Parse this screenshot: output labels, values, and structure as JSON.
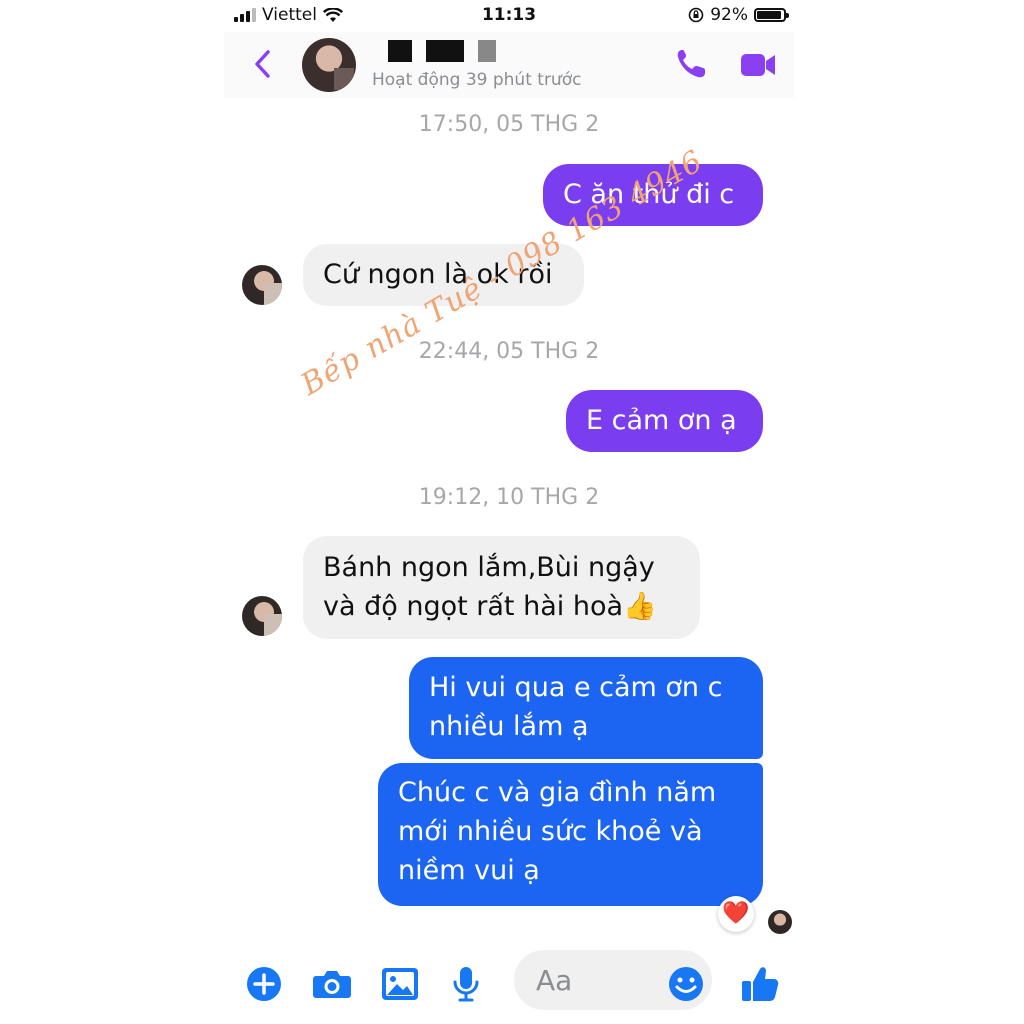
{
  "status_bar": {
    "carrier": "Viettel",
    "time": "11:13",
    "battery": "92%",
    "battery_level": 0.92
  },
  "header": {
    "active_status": "Hoạt động 39 phút trước"
  },
  "messages": [
    {
      "timestamp": "17:50, 05 THG 2"
    },
    {
      "outgoing_1": "C ăn thử đi c"
    },
    {
      "incoming_1": "Cứ ngon là ok rồi"
    },
    {
      "timestamp": "22:44, 05 THG 2"
    }
  ],
  "chat": {
    "ts1": "17:50, 05 THG 2",
    "msg_out_1": "C ăn thử đi c",
    "msg_in_1": "Cứ ngon là ok rồi",
    "ts2": "22:44, 05 THG 2",
    "msg_out_2": "E cảm ơn ạ",
    "ts3": "19:12, 10 THG 2",
    "msg_in_2": "Bánh ngon lắm,Bùi ngậy và độ ngọt rất hài hoà👍",
    "msg_out_3": "Hi vui qua e cảm ơn c nhiều lắm ạ",
    "msg_out_4": "Chúc c và gia đình năm mới nhiều sức khoẻ và niềm vui ạ",
    "reaction": "❤️"
  },
  "watermark": "Bếp nhà Tuệ - 098 163 4946",
  "composer": {
    "placeholder": "Aa"
  },
  "colors": {
    "accent_purple": "#7b3df0",
    "accent_blue": "#1c64f2",
    "icon_blue": "#1877f2"
  },
  "icons": [
    "back-icon",
    "phone-icon",
    "video-icon",
    "plus-icon",
    "camera-icon",
    "image-icon",
    "mic-icon",
    "emoji-icon",
    "thumbs-up-icon"
  ]
}
